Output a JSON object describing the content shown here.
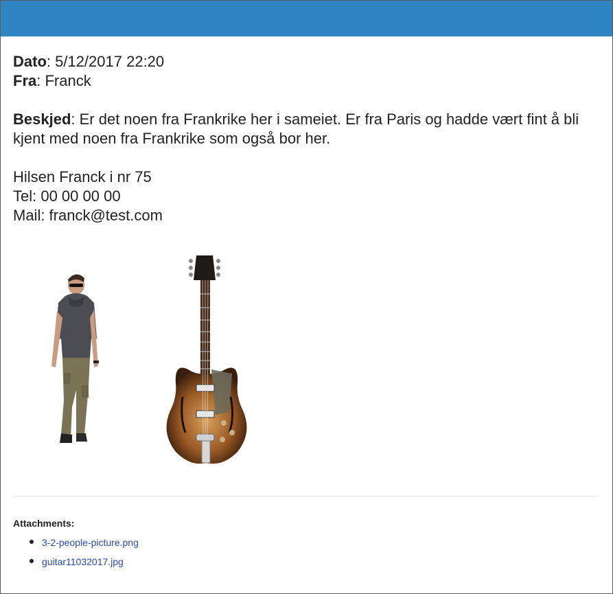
{
  "header": {
    "color": "#2f84c2"
  },
  "message": {
    "date_label": "Dato",
    "date_value": ": 5/12/2017 22:20",
    "from_label": "Fra",
    "from_value": ": Franck",
    "body_label": "Beskjed",
    "body_text": ": Er det noen fra Frankrike her i sameiet. Er fra Paris og hadde vært fint å bli kjent med noen fra Frankrike som også bor her.",
    "sign_line1": "Hilsen Franck i nr 75",
    "sign_line2": "Tel: 00 00 00 00",
    "sign_line3": "Mail: franck@test.com"
  },
  "images": [
    "person-walking-photo",
    "electric-guitar-photo"
  ],
  "attachments": {
    "title": "Attachments:",
    "items": [
      {
        "name": "3-2-people-picture.png"
      },
      {
        "name": "guitar11032017.jpg"
      }
    ]
  }
}
